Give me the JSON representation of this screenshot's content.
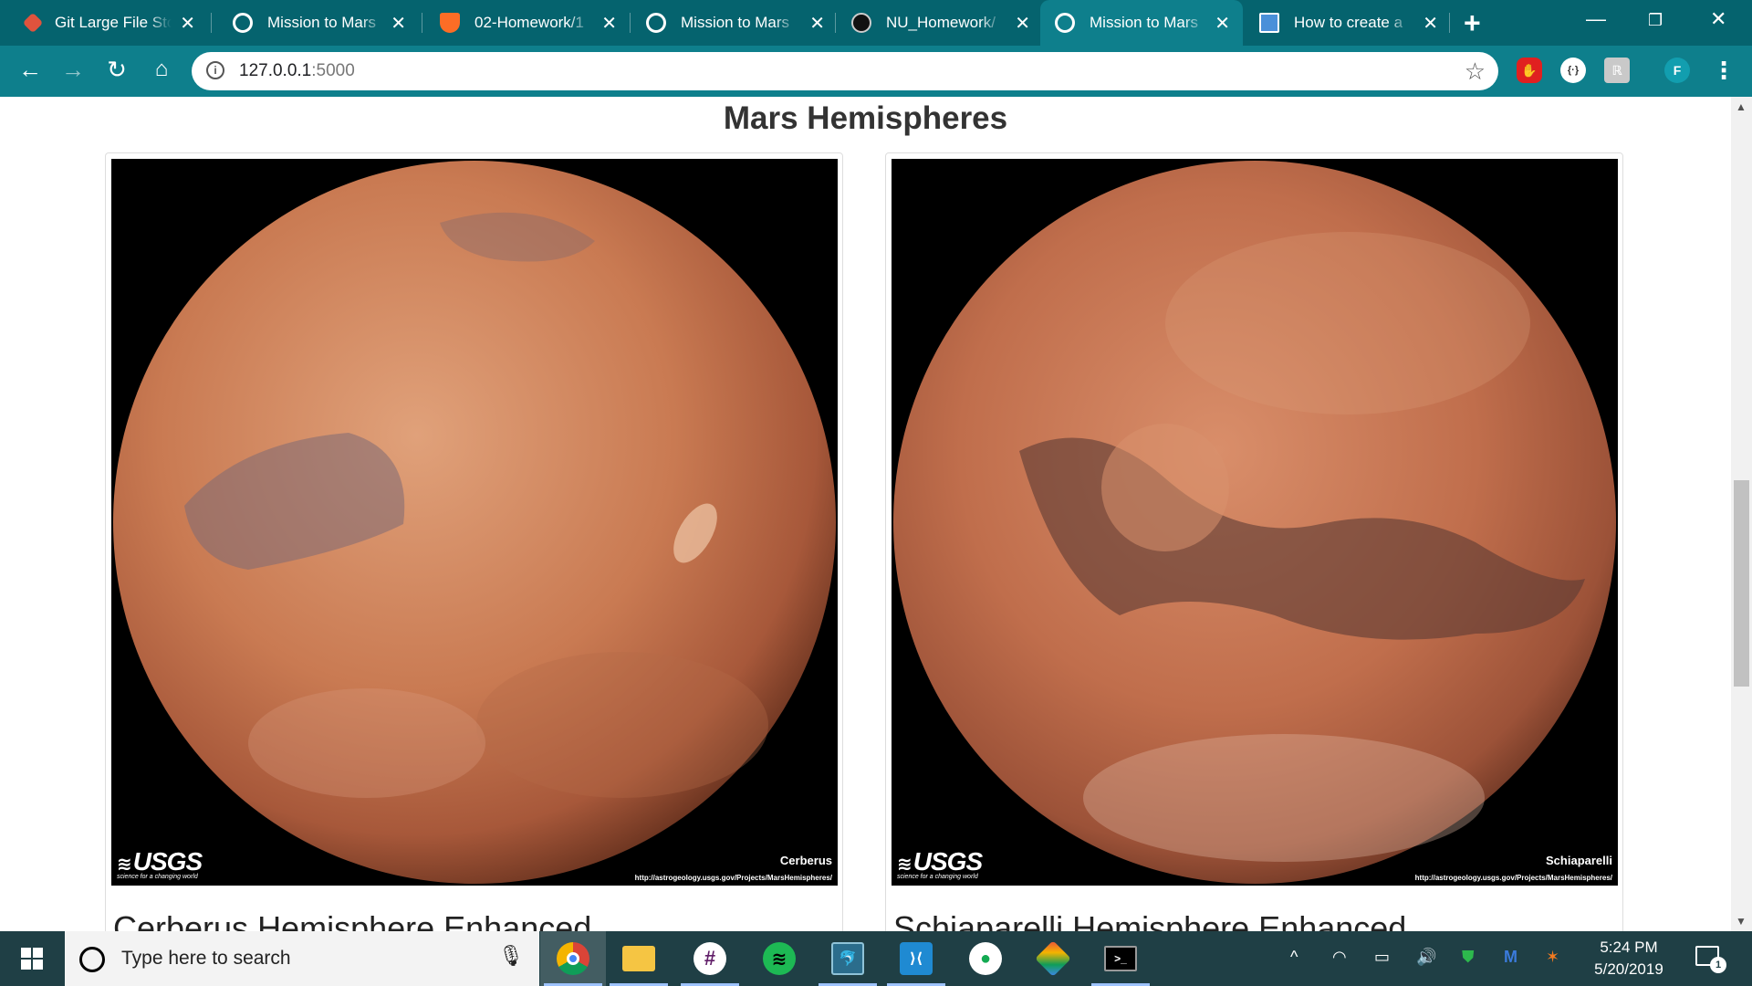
{
  "browser": {
    "tabs": [
      {
        "title": "Git Large File Sto",
        "icon": "git-lfs-icon",
        "color": "#e0533d"
      },
      {
        "title": "Mission to Mars",
        "icon": "globe-icon",
        "color": "#ffffff"
      },
      {
        "title": "02-Homework/1",
        "icon": "gitlab-icon",
        "color": "#fc6d26"
      },
      {
        "title": "Mission to Mars",
        "icon": "globe-icon",
        "color": "#ffffff"
      },
      {
        "title": "NU_Homework/",
        "icon": "github-icon",
        "color": "#111111"
      },
      {
        "title": "Mission to Mars",
        "icon": "globe-icon",
        "color": "#ffffff",
        "active": true
      },
      {
        "title": "How to create a",
        "icon": "page-icon",
        "color": "#4a90d9"
      }
    ],
    "address": {
      "host": "127.0.0.1",
      "port": ":5000"
    },
    "profile_initial": "F",
    "accent": "#0e7f8c",
    "tabbar_color": "#05636e"
  },
  "page": {
    "heading": "Mars Hemispheres",
    "hemispheres": [
      {
        "title": "Cerberus Hemisphere Enhanced",
        "image_label": "Cerberus",
        "image_url_text": "http://astrogeology.usgs.gov/Projects/MarsHemispheres/",
        "logo_text": "USGS",
        "logo_tagline": "science for a changing world"
      },
      {
        "title": "Schiaparelli Hemisphere Enhanced",
        "image_label": "Schiaparelli",
        "image_url_text": "http://astrogeology.usgs.gov/Projects/MarsHemispheres/",
        "logo_text": "USGS",
        "logo_tagline": "science for a changing world"
      }
    ]
  },
  "taskbar": {
    "search_placeholder": "Type here to search",
    "apps": [
      "chrome-icon",
      "file-explorer-icon",
      "slack-icon",
      "spotify-icon",
      "mysql-workbench-icon",
      "vscode-icon",
      "mongodb-compass-icon",
      "git-kraken-icon",
      "terminal-icon"
    ],
    "time": "5:24 PM",
    "date": "5/20/2019",
    "notification_count": "1",
    "color": "#1f3f45"
  }
}
